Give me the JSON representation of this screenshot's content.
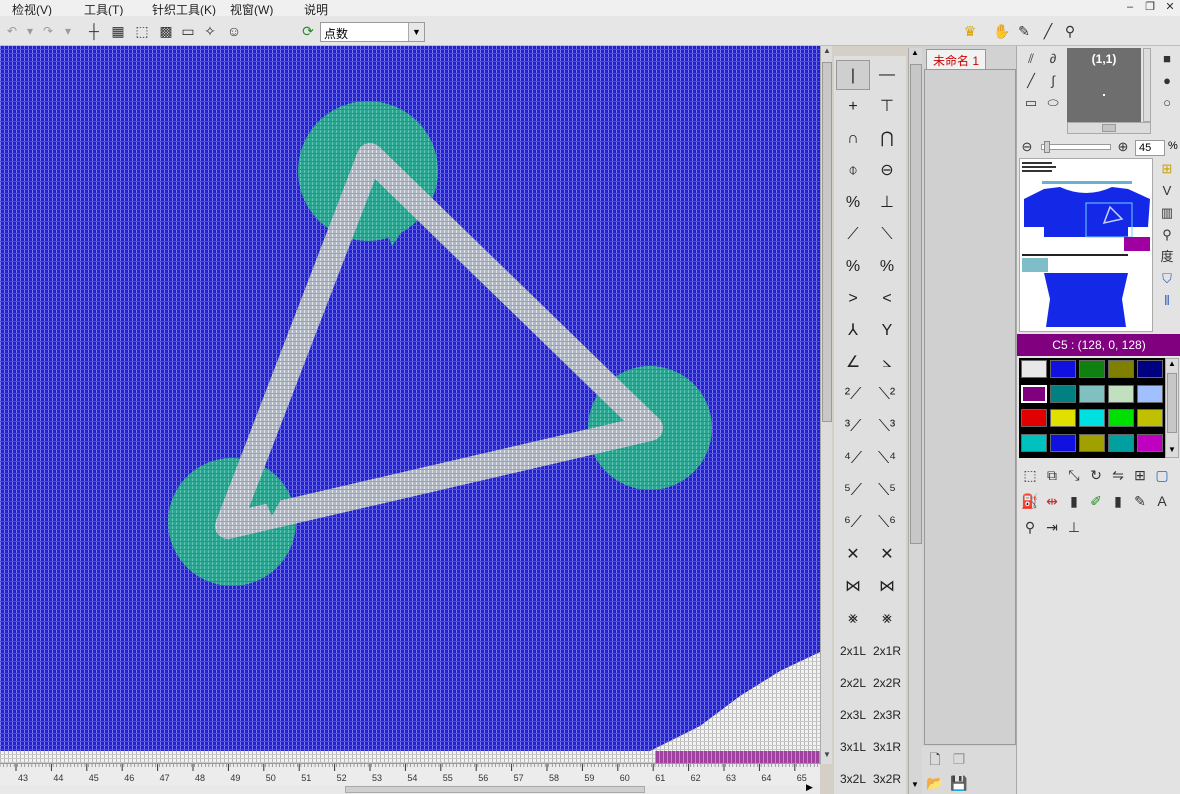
{
  "menu": {
    "view": "检视(V)",
    "tools": "工具(T)",
    "knit_tools": "针织工具(K)",
    "window": "视窗(W)",
    "help": "说明"
  },
  "toolbar": {
    "mode_select": "点数"
  },
  "document": {
    "tab": "未命名 1"
  },
  "ruler": {
    "labels": [
      "43",
      "44",
      "45",
      "46",
      "47",
      "48",
      "49",
      "50",
      "51",
      "52",
      "53",
      "54",
      "55",
      "56",
      "57",
      "58",
      "59",
      "60",
      "61",
      "62",
      "63",
      "64",
      "65"
    ]
  },
  "symbol_palette": {
    "text_items": [
      "2x1L",
      "2x1R",
      "2x2L",
      "2x2R",
      "2x3L",
      "2x3R",
      "3x1L",
      "3x1R",
      "3x2L",
      "3x2R"
    ]
  },
  "navigator": {
    "coord": "(1,1)",
    "zoom": "45",
    "zoom_unit": "%"
  },
  "color": {
    "current_label": "C5 : (128, 0, 128)",
    "swatches": [
      "#e8e8e8",
      "#1010e0",
      "#108010",
      "#808000",
      "#000080",
      "#800080",
      "#008080",
      "#80c0c0",
      "#c0e0c0",
      "#a0c0ff",
      "#e00000",
      "#e0e000",
      "#00e0e0",
      "#00e000",
      "#c0c000",
      "#00c0c0",
      "#1010e0",
      "#a0a000",
      "#00a0a0",
      "#c000c0"
    ],
    "selected_index": 5
  },
  "canvas": {
    "background_color": "#2222cc",
    "motif_fill": "#2aa590",
    "motif_line": "#b4bcc8"
  }
}
